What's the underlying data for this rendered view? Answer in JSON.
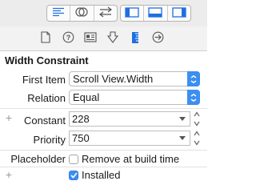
{
  "toolbar": {
    "left_group": [
      {
        "icon": "align-left-lines-icon"
      },
      {
        "icon": "overlapping-circles-icon"
      },
      {
        "icon": "swap-arrows-icon"
      }
    ],
    "right_group": [
      {
        "icon": "left-panel-icon",
        "selected": true
      },
      {
        "icon": "bottom-panel-icon",
        "selected": true
      },
      {
        "icon": "right-panel-icon",
        "selected": true
      }
    ],
    "accent": "#1f6fe0"
  },
  "inspector_tabs": [
    {
      "icon": "file-icon"
    },
    {
      "icon": "help-icon"
    },
    {
      "icon": "identity-card-icon"
    },
    {
      "icon": "attributes-icon"
    },
    {
      "icon": "size-ruler-icon",
      "selected": true
    },
    {
      "icon": "connections-arrow-icon"
    }
  ],
  "section": {
    "title": "Width Constraint"
  },
  "first_item": {
    "label": "First Item",
    "value": "Scroll View.Width"
  },
  "relation": {
    "label": "Relation",
    "value": "Equal"
  },
  "constant": {
    "label": "Constant",
    "value": "228"
  },
  "priority": {
    "label": "Priority",
    "value": "750"
  },
  "placeholder": {
    "label": "Placeholder",
    "checkbox_label": "Remove at build time",
    "checked": false
  },
  "installed": {
    "label": "Installed",
    "checked": true
  },
  "plus_symbol": "+",
  "colors": {
    "accent_blue": "#3b8ff0",
    "selected_icon": "#1f6fe0"
  }
}
